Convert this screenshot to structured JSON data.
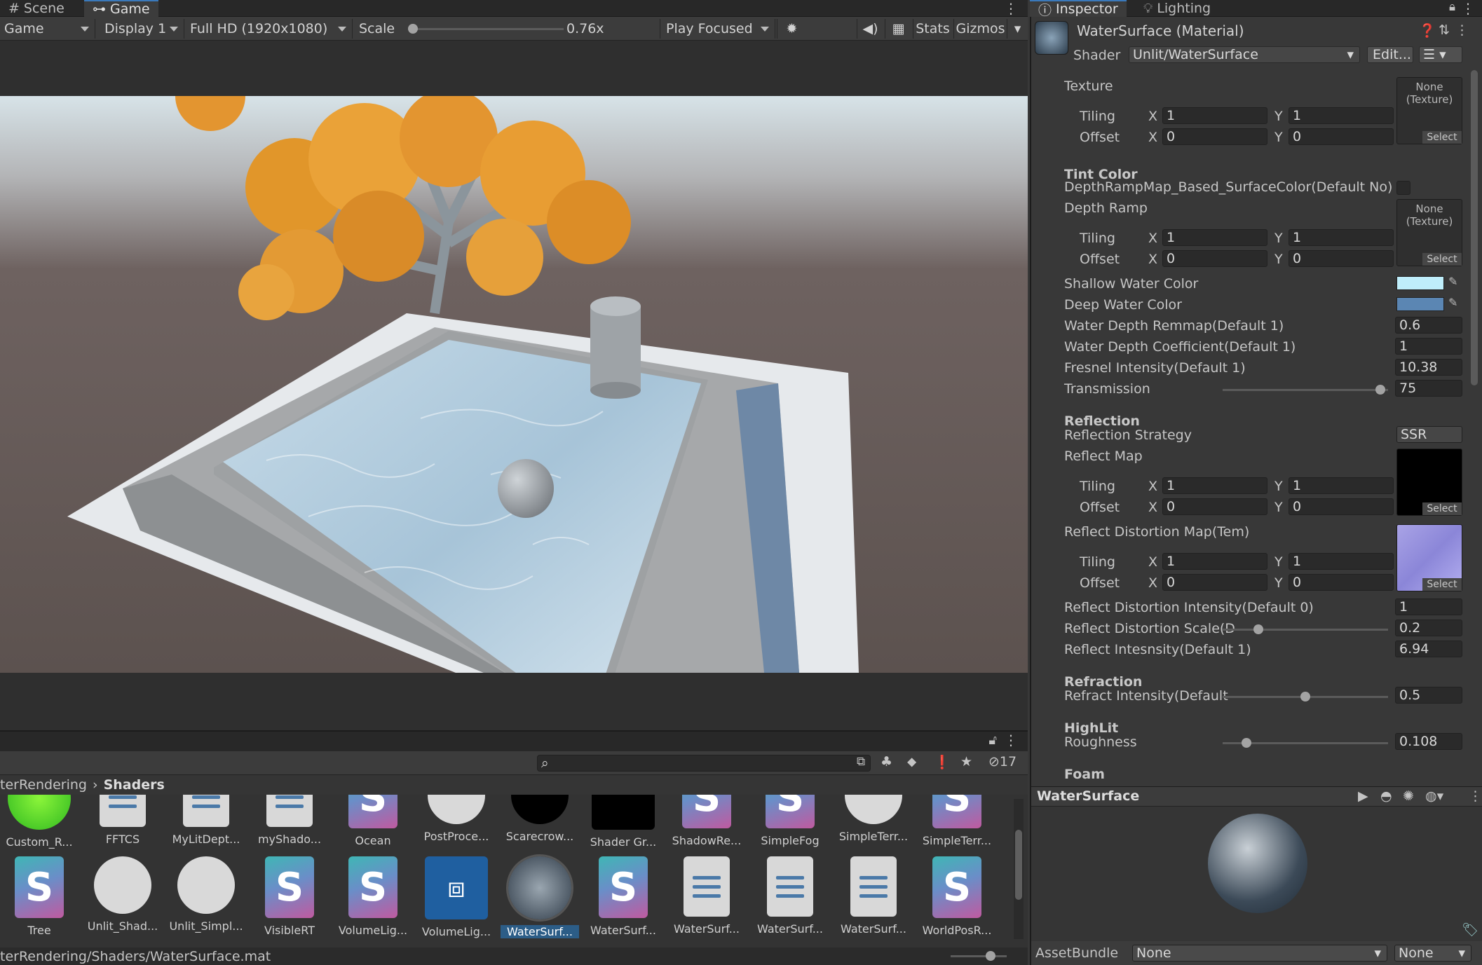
{
  "game_panel": {
    "tabs": [
      {
        "label": "Scene",
        "icon": "grid-icon"
      },
      {
        "label": "Game",
        "icon": "gamepad-icon"
      }
    ],
    "toolbar": {
      "mode": "Game",
      "display": "Display 1",
      "resolution": "Full HD (1920x1080)",
      "scale_label": "Scale",
      "scale_value": "0.76x",
      "scale_fraction": 0.0,
      "play_mode": "Play Focused",
      "stats": "Stats",
      "gizmos": "Gizmos"
    }
  },
  "project_panel": {
    "hidden_count": "17",
    "breadcrumb": {
      "parent": "terRendering",
      "current": "Shaders"
    },
    "assets_row1": [
      "Custom_R...",
      "FFTCS",
      "MyLitDept...",
      "myShado...",
      "Ocean",
      "PostProce...",
      "Scarecrow...",
      "Shader Gr...",
      "ShadowRe...",
      "SimpleFog",
      "SimpleTerr...",
      "SimpleTerr..."
    ],
    "assets_row2": [
      "Tree",
      "Unlit_Shad...",
      "Unlit_Simpl...",
      "VisibleRT",
      "VolumeLig...",
      "VolumeLig...",
      "WaterSurf...",
      "WaterSurf...",
      "WaterSurf...",
      "WaterSurf...",
      "WaterSurf...",
      "WorldPosR..."
    ],
    "status_path": "terRendering/Shaders/WaterSurface.mat"
  },
  "inspector": {
    "tabs": [
      {
        "label": "Inspector"
      },
      {
        "label": "Lighting"
      }
    ],
    "material_title": "WaterSurface (Material)",
    "shader_label": "Shader",
    "shader_value": "Unlit/WaterSurface",
    "edit_label": "Edit...",
    "texture": {
      "label": "Texture",
      "tiling": "Tiling",
      "offset": "Offset",
      "x": "X",
      "y": "Y",
      "tx": "1",
      "ty": "1",
      "ox": "0",
      "oy": "0",
      "none": "None",
      "tex": "(Texture)",
      "select": "Select"
    },
    "tint_color": "Tint Color",
    "depth_ramp_toggle": "DepthRampMap_Based_SurfaceColor(Default No)",
    "depth_ramp": {
      "label": "Depth Ramp",
      "tx": "1",
      "ty": "1",
      "ox": "0",
      "oy": "0"
    },
    "shallow_water_color": {
      "label": "Shallow Water Color",
      "color": "#bfeefb"
    },
    "deep_water_color": {
      "label": "Deep Water Color",
      "color": "#5b86b3"
    },
    "water_depth_remap": {
      "label": "Water Depth Remmap(Default 1)",
      "value": "0.6"
    },
    "water_depth_coeff": {
      "label": "Water Depth Coefficient(Default 1)",
      "value": "1"
    },
    "fresnel": {
      "label": "Fresnel Intensity(Default 1)",
      "value": "10.38"
    },
    "transmission": {
      "label": "Transmission",
      "value": "75",
      "fraction": 0.98
    },
    "reflection": "Reflection",
    "reflection_strategy": {
      "label": "Reflection Strategy",
      "value": "SSR"
    },
    "reflect_map": {
      "label": "Reflect Map",
      "tx": "1",
      "ty": "1",
      "ox": "0",
      "oy": "0"
    },
    "reflect_distortion_map": {
      "label": "Reflect Distortion Map(Tem)",
      "tx": "1",
      "ty": "1",
      "ox": "0",
      "oy": "0"
    },
    "reflect_distortion_intensity": {
      "label": "Reflect Distortion Intensity(Default 0)",
      "value": "1"
    },
    "reflect_distortion_scale": {
      "label": "Reflect Distortion Scale(D",
      "value": "0.2",
      "fraction": 0.2
    },
    "reflect_intensity": {
      "label": "Reflect Intesnsity(Default 1)",
      "value": "6.94"
    },
    "refraction": "Refraction",
    "refract_intensity": {
      "label": "Refract Intensity(Default",
      "value": "0.5",
      "fraction": 0.5
    },
    "highlit": "HighLit",
    "roughness": {
      "label": "Roughness",
      "value": "0.108",
      "fraction": 0.12
    },
    "foam": "Foam"
  },
  "preview": {
    "title": "WaterSurface",
    "assetbundle_label": "AssetBundle",
    "bundle_value": "None",
    "variant_value": "None"
  }
}
